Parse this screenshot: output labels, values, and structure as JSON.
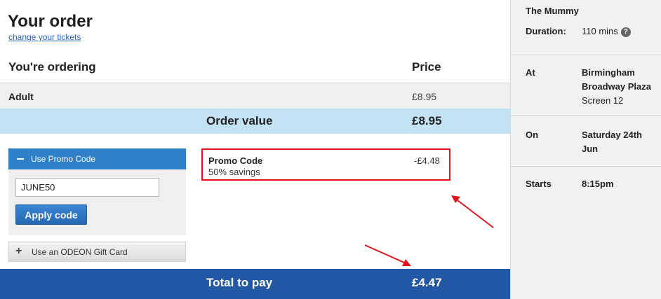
{
  "header": {
    "title": "Your order",
    "change_link": "change your tickets"
  },
  "table": {
    "col_item": "You're ordering",
    "col_price": "Price",
    "rows": [
      {
        "label": "Adult",
        "price": "£8.95"
      }
    ],
    "order_value_label": "Order value",
    "order_value": "£8.95"
  },
  "promo": {
    "toggle_label": "Use Promo Code",
    "code_value": "JUNE50",
    "apply_label": "Apply code"
  },
  "gift_card": {
    "label": "Use an ODEON Gift Card"
  },
  "promo_applied": {
    "name": "Promo Code",
    "savings": "50% savings",
    "amount": "-£4.48"
  },
  "total": {
    "label": "Total to pay",
    "value": "£4.47"
  },
  "sidebar": {
    "film": "The Mummy",
    "duration_label": "Duration:",
    "duration_value": "110 mins",
    "help_icon": "?",
    "at_label": "At",
    "cinema_line1": "Birmingham",
    "cinema_line2": "Broadway Plaza",
    "screen": "Screen 12",
    "on_label": "On",
    "date_line1": "Saturday 24th",
    "date_line2": "Jun",
    "starts_label": "Starts",
    "starts_value": "8:15pm"
  },
  "colors": {
    "order_value_bg": "#c3e3f5",
    "total_bg": "#2358a6",
    "promo_header_bg": "#2f7fc9",
    "highlight_red": "#e1141c"
  }
}
